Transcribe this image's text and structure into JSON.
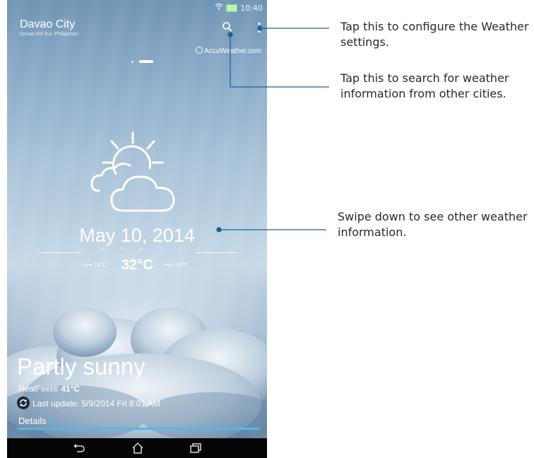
{
  "status": {
    "time": "10:40"
  },
  "header": {
    "city": "Davao City",
    "region": "Davao Del Sur, Philippines",
    "provider": "AccuWeather.com"
  },
  "forecast": {
    "date": "May 10, 2014",
    "weekdays": [
      "S",
      "M",
      "T",
      "W",
      "T",
      "F",
      "S"
    ],
    "low": "Low 23°C",
    "temperature": "32°C",
    "high": "High 32°C",
    "condition": "Partly sunny",
    "realfeel_label": "RealFeel®",
    "realfeel_value": "41°C",
    "last_update": "Last update: 5/9/2014 Fri  8:01 AM",
    "details_label": "Details"
  },
  "callouts": {
    "settings": "Tap this to configure the Weather settings.",
    "search": "Tap this to search for weather information from other cities.",
    "swipe": "Swipe down to see other weather information."
  },
  "colors": {
    "callout_line": "#1f5f99",
    "accent": "#57b7e6"
  },
  "icons": [
    "wifi-icon",
    "battery-icon",
    "search-icon",
    "more-options-icon",
    "partly-sunny-icon",
    "refresh-icon",
    "back-icon",
    "home-icon",
    "recent-apps-icon"
  ]
}
